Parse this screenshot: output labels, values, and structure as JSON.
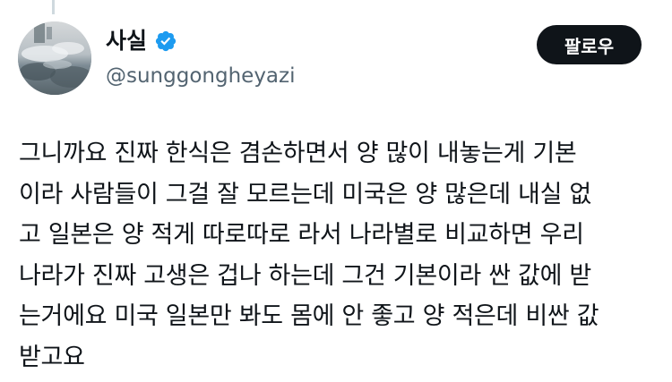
{
  "author": {
    "display_name": "사실",
    "handle": "@sunggongheyazi",
    "verified": true,
    "avatar": "sky-reflection-photo"
  },
  "actions": {
    "follow_label": "팔로우"
  },
  "tweet": {
    "text": "그니까요 진짜 한식은 겸손하면서 양 많이 내놓는게 기본\n이라 사람들이 그걸 잘 모르는데 미국은 양 많은데 내실 없\n고 일본은 양 적게 따로따로 라서 나라별로 비교하면 우리\n나라가 진짜 고생은 겁나 하는데 그건 기본이라 싼 값에 받\n는거에요 미국 일본만 봐도 몸에 안 좋고 양 적은데 비싼 값\n받고요"
  },
  "colors": {
    "verified_badge": "#1d9bf0",
    "follow_button_bg": "#0f1419",
    "handle_text": "#536471",
    "thread_line": "#cfd9de"
  }
}
